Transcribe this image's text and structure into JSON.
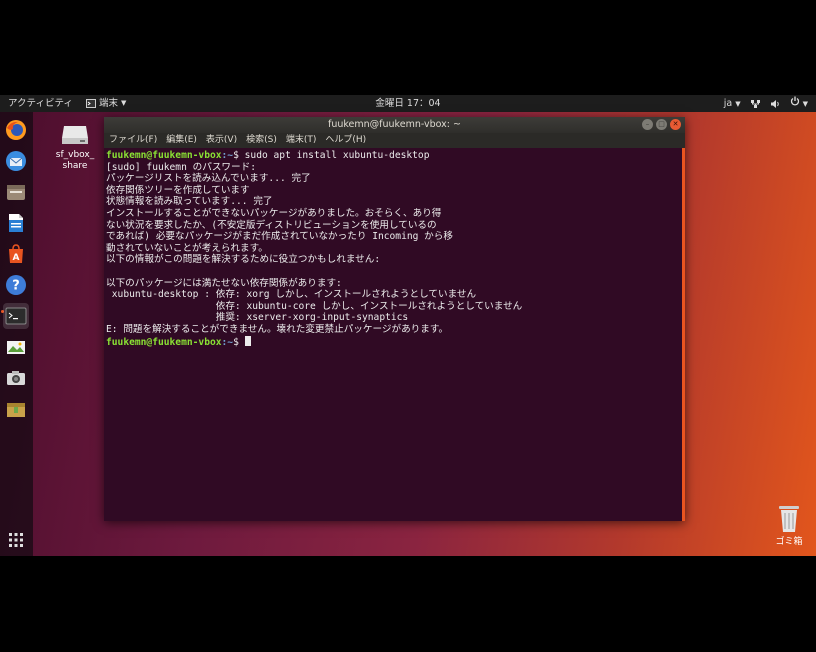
{
  "topbar": {
    "activities": "アクティビティ",
    "app_menu": "端末",
    "clock": "金曜日 17：04",
    "input_method": "ja"
  },
  "dock": {
    "items": [
      {
        "name": "firefox",
        "icon": "firefox-icon"
      },
      {
        "name": "thunderbird",
        "icon": "thunderbird-icon"
      },
      {
        "name": "files",
        "icon": "files-icon"
      },
      {
        "name": "libreoffice-writer",
        "icon": "writer-icon"
      },
      {
        "name": "software",
        "icon": "software-center-icon"
      },
      {
        "name": "help",
        "icon": "help-icon"
      },
      {
        "name": "terminal",
        "icon": "terminal-icon",
        "active": true
      },
      {
        "name": "image-viewer",
        "icon": "image-viewer-icon"
      },
      {
        "name": "screenshot",
        "icon": "camera-icon"
      },
      {
        "name": "archive",
        "icon": "archive-icon"
      }
    ],
    "show_apps_icon": "grid-icon"
  },
  "desktop": {
    "drive_label_1": "sf_vbox_",
    "drive_label_2": "share",
    "trash_label": "ゴミ箱"
  },
  "terminal": {
    "title": "fuukemn@fuukemn-vbox: ~",
    "menu": [
      "ファイル(F)",
      "編集(E)",
      "表示(V)",
      "検索(S)",
      "端末(T)",
      "ヘルプ(H)"
    ],
    "prompt_user": "fuukemn@fuukemn-vbox",
    "prompt_path": ":~",
    "prompt_symbol": "$",
    "command": " sudo apt install xubuntu-desktop",
    "output": [
      "[sudo] fuukemn のパスワード:",
      "パッケージリストを読み込んでいます... 完了",
      "依存関係ツリーを作成しています",
      "状態情報を読み取っています... 完了",
      "インストールすることができないパッケージがありました。おそらく、あり得",
      "ない状況を要求したか、(不安定版ディストリビューションを使用しているの",
      "であれば) 必要なパッケージがまだ作成されていなかったり Incoming から移",
      "動されていないことが考えられます。",
      "以下の情報がこの問題を解決するために役立つかもしれません:",
      "",
      "以下のパッケージには満たせない依存関係があります:",
      " xubuntu-desktop : 依存: xorg しかし、インストールされようとしていません",
      "                   依存: xubuntu-core しかし、インストールされようとしていません",
      "                   推奨: xserver-xorg-input-synaptics",
      "E: 問題を解決することができません。壊れた変更禁止パッケージがあります。"
    ]
  }
}
